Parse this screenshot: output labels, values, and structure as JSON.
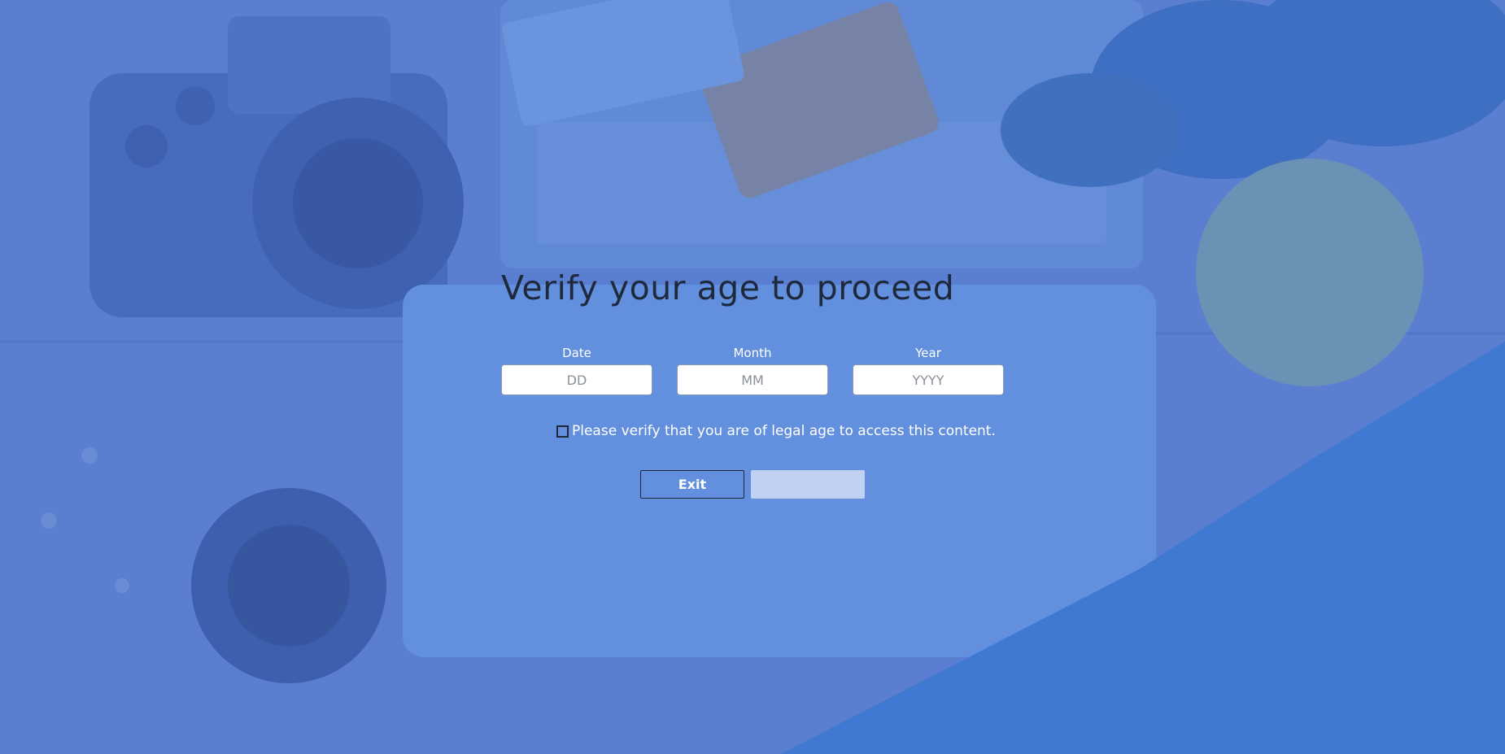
{
  "modal": {
    "title": "Verify your age to proceed",
    "fields": [
      {
        "label": "Date",
        "placeholder": "DD"
      },
      {
        "label": "Month",
        "placeholder": "MM"
      },
      {
        "label": "Year",
        "placeholder": "YYYY"
      }
    ],
    "checkbox_label": "Please verify that you are of legal age to access this content.",
    "exit_label": "Exit",
    "confirm_label": ""
  },
  "colors": {
    "overlay": "#4d7dd7",
    "title": "#1e2a3c",
    "confirm_disabled": "#d7e1f5"
  }
}
